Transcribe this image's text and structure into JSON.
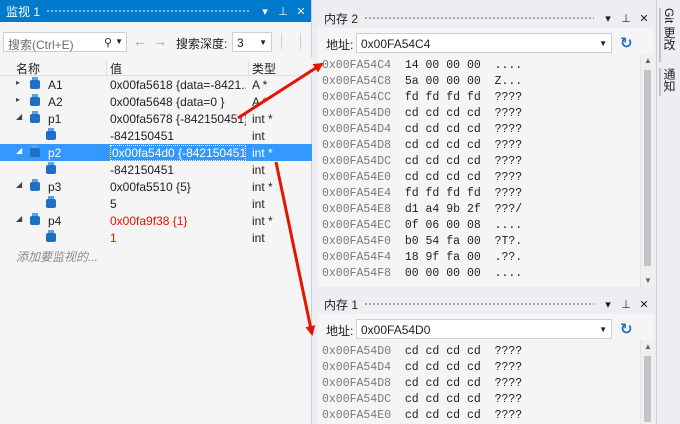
{
  "watch": {
    "title": "监视 1",
    "search_placeholder": "搜索(Ctrl+E)",
    "depth_label": "搜索深度:",
    "depth_value": "3",
    "columns": {
      "name": "名称",
      "value": "值",
      "type": "类型"
    },
    "rows": [
      {
        "name": "A1",
        "value": "0x00fa5618 {data=-8421...",
        "type": "A *",
        "expander": "▸",
        "level": 0,
        "red": false
      },
      {
        "name": "A2",
        "value": "0x00fa5648 {data=0 }",
        "type": "A *",
        "expander": "▸",
        "level": 0,
        "red": false
      },
      {
        "name": "p1",
        "value": "0x00fa5678 {-842150451}",
        "type": "int *",
        "expander": "◢",
        "level": 0,
        "red": false
      },
      {
        "name": "",
        "value": "-842150451",
        "type": "int",
        "expander": "",
        "level": 1,
        "red": false
      },
      {
        "name": "p2",
        "value": "0x00fa54d0 {-842150451}",
        "type": "int *",
        "expander": "◢",
        "level": 0,
        "red": false,
        "selected": true
      },
      {
        "name": "",
        "value": "-842150451",
        "type": "int",
        "expander": "",
        "level": 1,
        "red": false
      },
      {
        "name": "p3",
        "value": "0x00fa5510 {5}",
        "type": "int *",
        "expander": "◢",
        "level": 0,
        "red": false
      },
      {
        "name": "",
        "value": "5",
        "type": "int",
        "expander": "",
        "level": 1,
        "red": false
      },
      {
        "name": "p4",
        "value": "0x00fa9f38 {1}",
        "type": "int *",
        "expander": "◢",
        "level": 0,
        "red": true
      },
      {
        "name": "",
        "value": "1",
        "type": "int",
        "expander": "",
        "level": 1,
        "red": true
      }
    ],
    "add_watch": "添加要监视的..."
  },
  "mem2": {
    "title": "内存 2",
    "addr_label": "地址:",
    "address": "0x00FA54C4",
    "lines": [
      {
        "addr": "0x00FA54C4",
        "bytes": "14 00 00 00",
        "ascii": "...."
      },
      {
        "addr": "0x00FA54C8",
        "bytes": "5a 00 00 00",
        "ascii": "Z..."
      },
      {
        "addr": "0x00FA54CC",
        "bytes": "fd fd fd fd",
        "ascii": "????"
      },
      {
        "addr": "0x00FA54D0",
        "bytes": "cd cd cd cd",
        "ascii": "????"
      },
      {
        "addr": "0x00FA54D4",
        "bytes": "cd cd cd cd",
        "ascii": "????"
      },
      {
        "addr": "0x00FA54D8",
        "bytes": "cd cd cd cd",
        "ascii": "????"
      },
      {
        "addr": "0x00FA54DC",
        "bytes": "cd cd cd cd",
        "ascii": "????"
      },
      {
        "addr": "0x00FA54E0",
        "bytes": "cd cd cd cd",
        "ascii": "????"
      },
      {
        "addr": "0x00FA54E4",
        "bytes": "fd fd fd fd",
        "ascii": "????"
      },
      {
        "addr": "0x00FA54E8",
        "bytes": "d1 a4 9b 2f",
        "ascii": "???/"
      },
      {
        "addr": "0x00FA54EC",
        "bytes": "0f 06 00 08",
        "ascii": "...."
      },
      {
        "addr": "0x00FA54F0",
        "bytes": "b0 54 fa 00",
        "ascii": "?T?."
      },
      {
        "addr": "0x00FA54F4",
        "bytes": "18 9f fa 00",
        "ascii": ".??."
      },
      {
        "addr": "0x00FA54F8",
        "bytes": "00 00 00 00",
        "ascii": "...."
      }
    ]
  },
  "mem1": {
    "title": "内存 1",
    "addr_label": "地址:",
    "address": "0x00FA54D0",
    "lines": [
      {
        "addr": "0x00FA54D0",
        "bytes": "cd cd cd cd",
        "ascii": "????"
      },
      {
        "addr": "0x00FA54D4",
        "bytes": "cd cd cd cd",
        "ascii": "????"
      },
      {
        "addr": "0x00FA54D8",
        "bytes": "cd cd cd cd",
        "ascii": "????"
      },
      {
        "addr": "0x00FA54DC",
        "bytes": "cd cd cd cd",
        "ascii": "????"
      },
      {
        "addr": "0x00FA54E0",
        "bytes": "cd cd cd cd",
        "ascii": "????"
      }
    ]
  },
  "side_tabs": {
    "git": "Git 更改",
    "notify": "通知"
  },
  "colors": {
    "accent": "#007acc",
    "selection": "#3399ff",
    "arrow": "#e51400"
  },
  "icons": {
    "pin": "pin-icon",
    "close": "close-icon",
    "dropdown": "dropdown-icon",
    "refresh": "refresh-icon"
  }
}
